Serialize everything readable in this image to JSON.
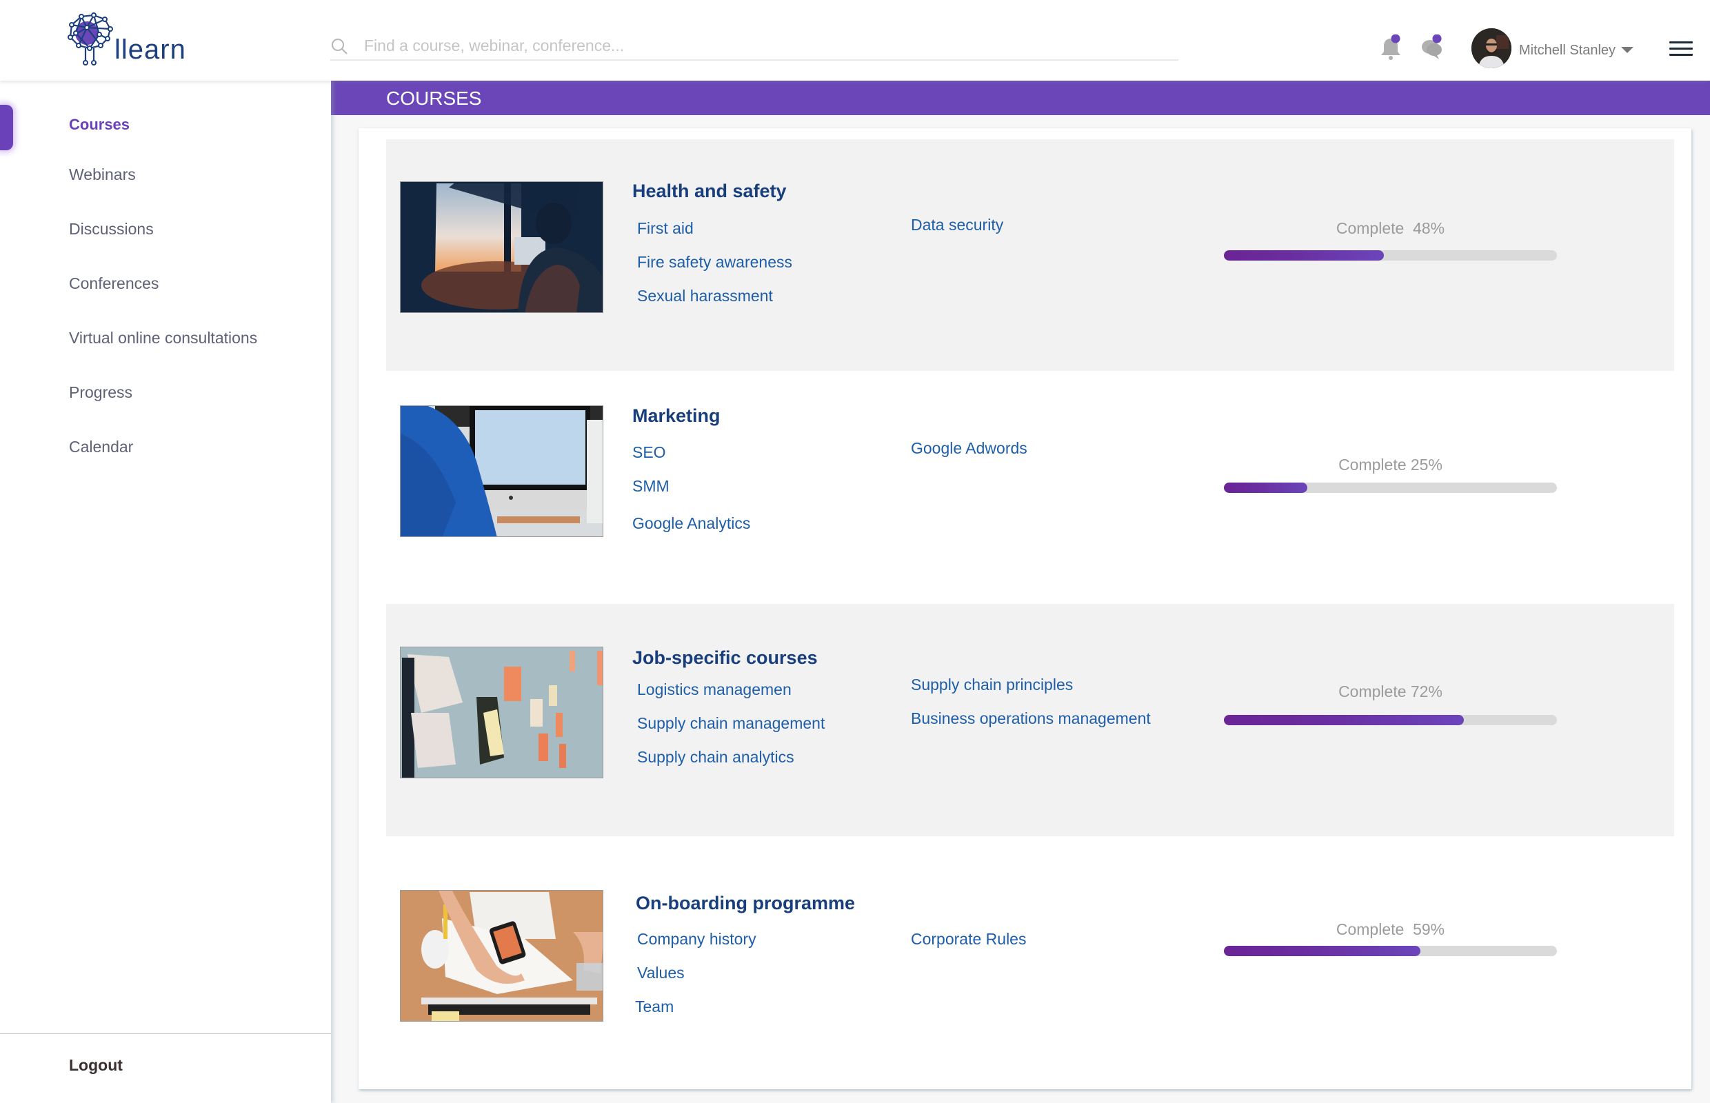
{
  "app": {
    "logo_text": "llearn",
    "logo_icon": "brain-network-icon"
  },
  "header": {
    "search": {
      "placeholder": "Find a course, webinar, conference...",
      "value": "",
      "icon": "search-icon"
    },
    "notifications": {
      "icon": "bell-icon",
      "has_unread": true
    },
    "messages": {
      "icon": "chat-icon",
      "has_unread": true
    },
    "user": {
      "name": "Mitchell Stanley",
      "avatar": "user-avatar-photo",
      "menu_icon": "caret-down-icon"
    },
    "menu_icon": "hamburger-menu-icon"
  },
  "sidebar": {
    "items": [
      {
        "label": "Courses",
        "active": true
      },
      {
        "label": "Webinars",
        "active": false
      },
      {
        "label": "Discussions",
        "active": false
      },
      {
        "label": "Conferences",
        "active": false
      },
      {
        "label": "Virtual online consultations",
        "active": false
      },
      {
        "label": "Progress",
        "active": false
      },
      {
        "label": "Calendar",
        "active": false
      }
    ],
    "logout_label": "Logout"
  },
  "banner": {
    "title": "COURSES"
  },
  "colors": {
    "accent": "#6b46b8",
    "title": "#183f7c",
    "link": "#1e5ea8",
    "progress_track": "#dadada"
  },
  "courses": [
    {
      "title": "Health and safety",
      "thumbnail": "person-at-window-sunset-photo",
      "col1": [
        "First aid",
        "Fire safety awareness",
        "Sexual harassment"
      ],
      "col2": [
        "Data security"
      ],
      "progress": {
        "label": "Complete",
        "value_text": "48%",
        "percent": 48
      }
    },
    {
      "title": "Marketing",
      "thumbnail": "person-at-imac-photo",
      "col1": [
        "SEO",
        "SMM",
        "Google Analytics"
      ],
      "col2": [
        "Google Adwords"
      ],
      "progress": {
        "label": "Complete",
        "value_text": "25%",
        "percent": 25
      }
    },
    {
      "title": "Job-specific courses",
      "thumbnail": "sticky-notes-wall-photo",
      "col1": [
        "Logistics managemen",
        "Supply chain management",
        "Supply chain analytics"
      ],
      "col2": [
        "Supply chain principles",
        "Business operations management"
      ],
      "progress": {
        "label": "Complete",
        "value_text": "72%",
        "percent": 72
      }
    },
    {
      "title": "On-boarding programme",
      "thumbnail": "desk-with-phone-and-papers-photo",
      "col1": [
        "Company history",
        "Values",
        "Team"
      ],
      "col2": [
        "Corporate Rules"
      ],
      "progress": {
        "label": "Complete",
        "value_text": "59%",
        "percent": 59
      }
    }
  ]
}
